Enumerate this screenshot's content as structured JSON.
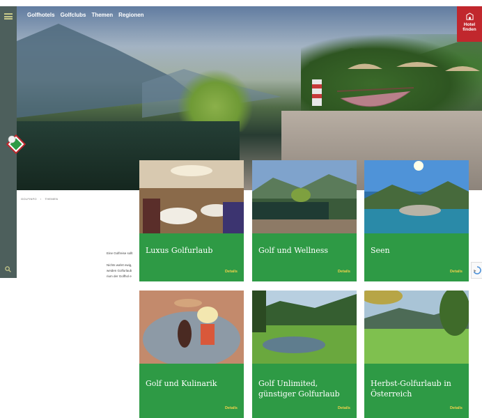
{
  "topnav": {
    "items": [
      "Golfhotels",
      "Golfclubs",
      "Themen",
      "Regionen"
    ]
  },
  "hotel_finder": {
    "line1": "Hotel",
    "line2": "finden",
    "icon": "hotel-icon"
  },
  "breadcrumb": [
    "GOLFINFO",
    "THEMEN"
  ],
  "body_text": {
    "line1": "Eine Golfreise sollt",
    "line2": "Nichts wahrt ewig,",
    "line3": "weiden Golfurlaub",
    "line4": "rium der Golfhol e"
  },
  "cards": [
    {
      "title": "Luxus Golfurlaub",
      "details": "Details"
    },
    {
      "title": "Golf und Wellness",
      "details": "Details"
    },
    {
      "title": "Seen",
      "details": "Details"
    },
    {
      "title": "Golf und Kulinarik",
      "details": "Details"
    },
    {
      "title": "Golf Unlimited, günstiger Golfurlaub",
      "details": "Details"
    },
    {
      "title": "Herbst-Golfurlaub in Österreich",
      "details": "Details"
    }
  ],
  "colors": {
    "card_green": "#2e9a45",
    "details_yellow": "#f0d14a",
    "hotel_finder_red": "#c1272d",
    "sidebar": "#4d5f5c"
  }
}
